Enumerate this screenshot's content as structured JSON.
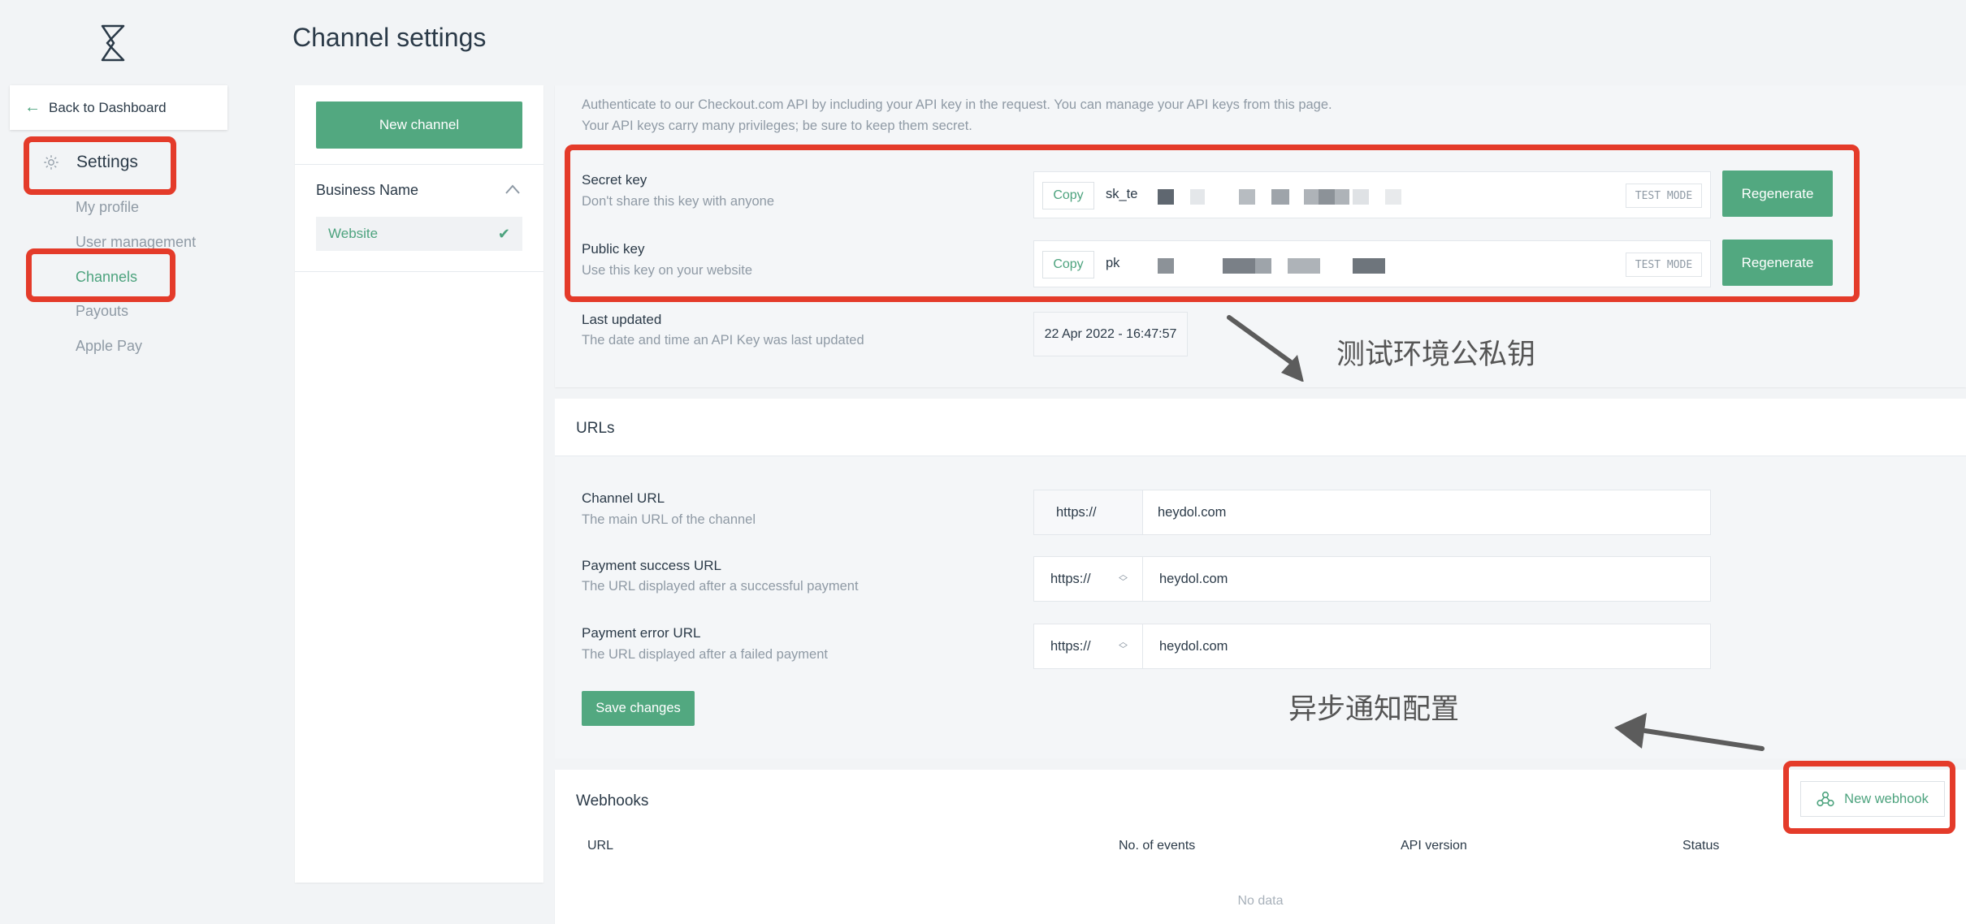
{
  "sidebar": {
    "back_label": "Back to Dashboard",
    "settings_label": "Settings",
    "items": [
      {
        "label": "My profile"
      },
      {
        "label": "User management"
      },
      {
        "label": "Channels"
      },
      {
        "label": "Payouts"
      },
      {
        "label": "Apple Pay"
      }
    ]
  },
  "page": {
    "title": "Channel settings"
  },
  "channels": {
    "new_label": "New channel",
    "business_name": "Business Name",
    "website_label": "Website"
  },
  "api": {
    "intro_line1": "Authenticate to our Checkout.com API by including your API key in the request. You can manage your API keys from this page.",
    "intro_line2": "Your API keys carry many privileges; be sure to keep them secret.",
    "secret": {
      "label": "Secret key",
      "sub": "Don't share this key with anyone",
      "copy": "Copy",
      "value_prefix": "sk_te",
      "badge": "TEST MODE",
      "regen": "Regenerate"
    },
    "public": {
      "label": "Public key",
      "sub": "Use this key on your website",
      "copy": "Copy",
      "value_prefix": "pk",
      "badge": "TEST MODE",
      "regen": "Regenerate"
    },
    "last_updated": {
      "label": "Last updated",
      "sub": "The date and time an API Key was last updated",
      "value": "22 Apr 2022 - 16:47:57"
    }
  },
  "annotations": {
    "keys_note": "测试环境公私钥",
    "webhook_note": "异步通知配置"
  },
  "urls": {
    "title": "URLs",
    "channel": {
      "label": "Channel URL",
      "sub": "The main URL of the channel",
      "protocol": "https://",
      "value": "heydol.com"
    },
    "success": {
      "label": "Payment success URL",
      "sub": "The URL displayed after a successful payment",
      "protocol": "https://",
      "value": "heydol.com"
    },
    "error": {
      "label": "Payment error URL",
      "sub": "The URL displayed after a failed payment",
      "protocol": "https://",
      "value": "heydol.com"
    },
    "save_label": "Save changes"
  },
  "webhooks": {
    "title": "Webhooks",
    "new_label": "New webhook",
    "columns": [
      "URL",
      "No. of events",
      "API version",
      "Status"
    ],
    "empty": "No data"
  },
  "colors": {
    "accent": "#52a880",
    "highlight": "#e43b2a"
  }
}
